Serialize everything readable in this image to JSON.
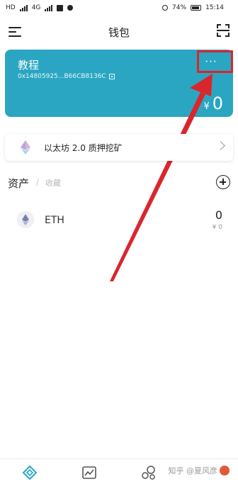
{
  "status_bar": {
    "left_indicators": [
      "HD",
      "4G"
    ],
    "battery": "74%",
    "time": "15:14"
  },
  "header": {
    "title": "钱包",
    "menu_icon": "hamburger-menu-icon",
    "scan_icon": "scan-icon"
  },
  "wallet_card": {
    "name": "教程",
    "address": "0x14805925...B66CB8136C",
    "more_label": "···",
    "currency_symbol": "¥",
    "balance": "0",
    "background_color": "#2aa6c2"
  },
  "banner": {
    "label": "以太坊 2.0 质押挖矿",
    "icon": "eth2-logo-icon"
  },
  "assets": {
    "tab_assets": "资产",
    "separator": "/",
    "tab_collectibles": "收藏",
    "add_icon": "add-circle-icon"
  },
  "tokens": [
    {
      "symbol": "ETH",
      "amount": "0",
      "value": "¥ 0",
      "icon": "ethereum-icon"
    }
  ],
  "bottom_nav": {
    "items": [
      {
        "icon": "wallet-diamond-icon",
        "active": true
      },
      {
        "icon": "market-chart-icon",
        "active": false
      },
      {
        "icon": "discover-bubbles-icon",
        "active": false
      }
    ],
    "watermark": "知乎 @夏风彦"
  },
  "annotation": {
    "color": "#d9262c"
  }
}
